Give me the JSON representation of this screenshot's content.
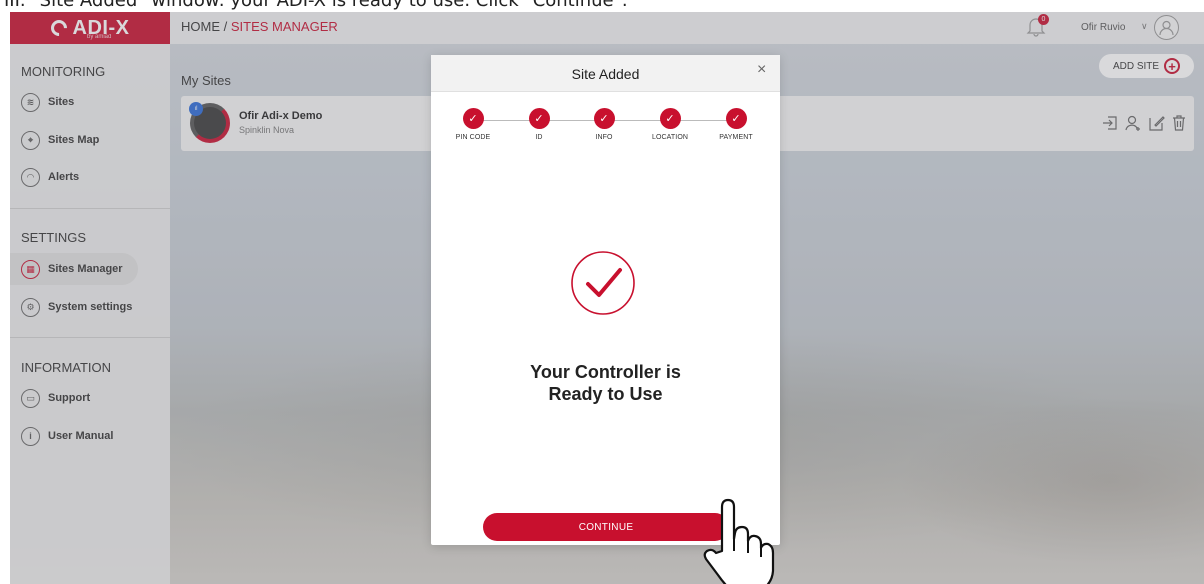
{
  "caption": "III. \"Site Added\" window: your ADI-X is ready to use. Click \"Continue\".",
  "brand": {
    "name": "ADI-X",
    "tagline": "by amiad",
    "accent": "#c8102e"
  },
  "header": {
    "crumb_home": "HOME / ",
    "crumb_current": "SITES MANAGER",
    "notification_count": "0",
    "user_name": "Ofir Ruvio"
  },
  "sidebar": {
    "sections": [
      {
        "title": "MONITORING",
        "items": [
          {
            "label": "Sites",
            "icon": "stack-icon"
          },
          {
            "label": "Sites Map",
            "icon": "map-pin-icon"
          },
          {
            "label": "Alerts",
            "icon": "bell-icon"
          }
        ]
      },
      {
        "title": "SETTINGS",
        "items": [
          {
            "label": "Sites Manager",
            "icon": "controller-icon",
            "active": true
          },
          {
            "label": "System settings",
            "icon": "gear-icon"
          }
        ]
      },
      {
        "title": "INFORMATION",
        "items": [
          {
            "label": "Support",
            "icon": "chat-icon"
          },
          {
            "label": "User Manual",
            "icon": "info-icon"
          }
        ]
      }
    ]
  },
  "main": {
    "title": "My Sites",
    "add_site_label": "ADD SITE",
    "sites": [
      {
        "name": "Ofir Adi-x Demo",
        "subtitle": "Spinklin Nova"
      }
    ]
  },
  "modal": {
    "title": "Site Added",
    "close": "×",
    "steps": [
      "PIN CODE",
      "ID",
      "INFO",
      "LOCATION",
      "PAYMENT"
    ],
    "message": "Your Controller is Ready to Use",
    "continue_label": "CONTINUE"
  }
}
